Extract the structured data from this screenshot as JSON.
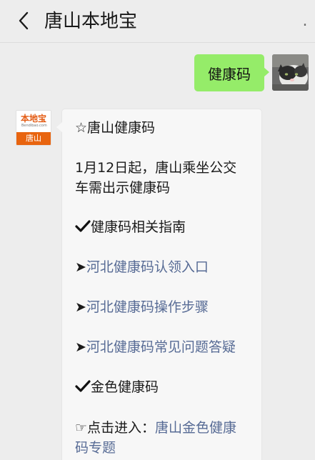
{
  "header": {
    "title": "唐山本地宝",
    "back_icon": "chevron-left-icon",
    "more_glyph": "."
  },
  "messages": {
    "outgoing": {
      "text": "健康码"
    },
    "incoming": {
      "avatar": {
        "brand": "本地宝",
        "brand_sub": "Bendibao.com",
        "city": "唐山"
      },
      "lines": {
        "heading": "☆唐山健康码",
        "notice_line1": "1月12日起，唐山乘坐公交",
        "notice_line2": "车需出示健康码",
        "section1": "健康码相关指南",
        "arrow": "➤",
        "link1": "河北健康码认领入口",
        "link2": "河北健康码操作步骤",
        "link3": "河北健康码常见问题答疑",
        "section2": "金色健康码",
        "click_prefix": "☞点击进入：",
        "link4_part1": "唐山金色健康",
        "link4_part2": "码专题"
      }
    }
  },
  "colors": {
    "background": "#ededed",
    "outgoing_bubble": "#95ec69",
    "link": "#576b95",
    "brand_orange": "#e8640f"
  }
}
